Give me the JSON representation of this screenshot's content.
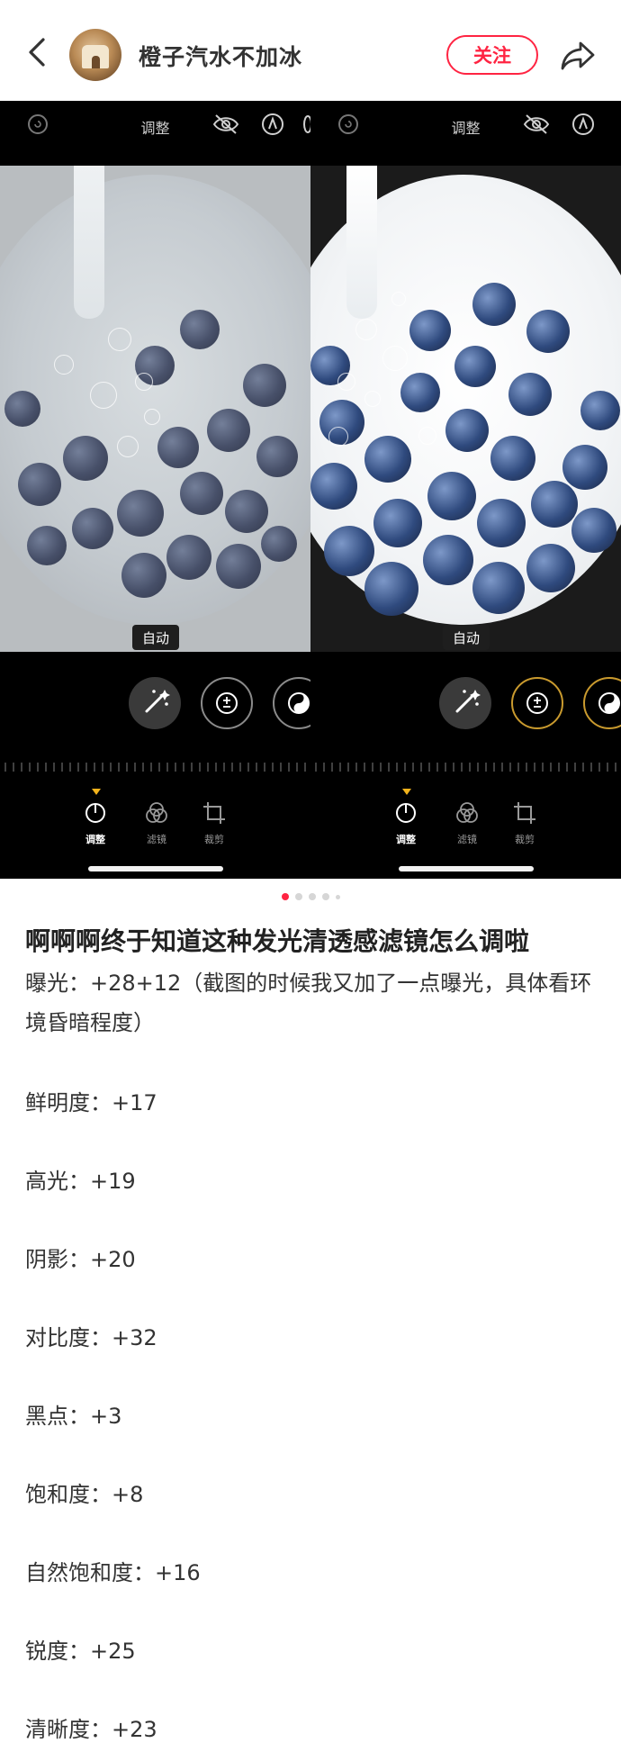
{
  "header": {
    "username": "橙子汽水不加冰",
    "follow_label": "关注"
  },
  "editor": {
    "topbar_label": "调整",
    "auto_badge": "自动",
    "tabs": [
      "调整",
      "滤镜",
      "裁剪"
    ],
    "accent_color": "#f2b31c"
  },
  "carousel": {
    "total_pages": 5,
    "current_page": 1
  },
  "post": {
    "title": "啊啊啊终于知道这种发光清透感滤镜怎么调啦",
    "intro": "曝光：+28+12（截图的时候我又加了一点曝光，具体看环境昏暗程度）",
    "params": [
      "鲜明度：+17",
      "高光：+19",
      "阴影：+20",
      "对比度：+32",
      "黑点：+3",
      "饱和度：+8",
      "自然饱和度：+16",
      "锐度：+25",
      "清晰度：+23"
    ]
  },
  "colors": {
    "brand": "#ff2442",
    "text": "#333333"
  }
}
